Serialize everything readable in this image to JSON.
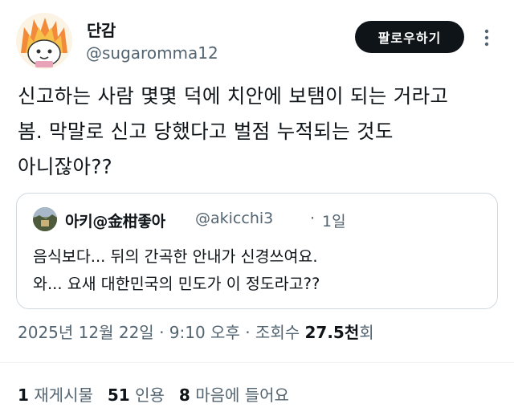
{
  "author": {
    "display_name": "단감",
    "handle": "@sugaromma12",
    "follow_label": "팔로우하기"
  },
  "tweet": {
    "lines": [
      "신고하는 사람 몇몇 덕에 치안에 보탬이 되는 거라고",
      "봄. 막말로 신고 당했다고 벌점 누적되는 것도",
      "아니잖아??"
    ]
  },
  "quote": {
    "name": "아키@金柑좋아",
    "handle": "@akicchi3",
    "separator": "·",
    "time": "1일",
    "lines": [
      "음식보다... 뒤의 간곡한 안내가 신경쓰여요.",
      "와... 요새 대한민국의 민도가 이 정도라고??"
    ]
  },
  "meta": {
    "date": "2025년 12월 22일 · 9:10 오후 · 조회수 ",
    "views": "27.5천",
    "views_unit": "회"
  },
  "stats": {
    "reposts_count": "1",
    "reposts_label": "재게시물",
    "quotes_count": "51",
    "quotes_label": "인용",
    "likes_count": "8",
    "likes_label": "마음에 들어요"
  },
  "icons": {
    "more": "more-vertical-icon",
    "avatar": "flame-character-avatar",
    "quote_avatar": "photo-avatar"
  }
}
